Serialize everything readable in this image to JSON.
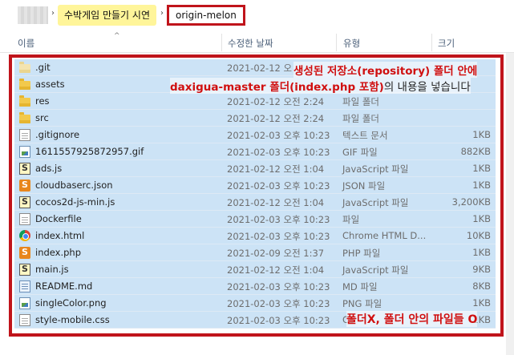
{
  "breadcrumb": {
    "parent": "수박게임 만들기 시연",
    "current": "origin-melon"
  },
  "columns": {
    "name": "이름",
    "date": "수정한 날짜",
    "type": "유형",
    "size": "크기"
  },
  "files": [
    {
      "name": ".git",
      "date": "2021-02-12 오",
      "type": "",
      "size": "",
      "icon": "folder-pale-icon"
    },
    {
      "name": "assets",
      "date": "",
      "type": "",
      "size": "",
      "icon": "folder-icon"
    },
    {
      "name": "res",
      "date": "2021-02-12 오전 2:24",
      "type": "파일 폴더",
      "size": "",
      "icon": "folder-icon"
    },
    {
      "name": "src",
      "date": "2021-02-12 오전 2:24",
      "type": "파일 폴더",
      "size": "",
      "icon": "folder-icon"
    },
    {
      "name": ".gitignore",
      "date": "2021-02-03 오후 10:23",
      "type": "텍스트 문서",
      "size": "1KB",
      "icon": "text-file-icon"
    },
    {
      "name": "1611557925872957.gif",
      "date": "2021-02-03 오후 10:23",
      "type": "GIF 파일",
      "size": "882KB",
      "icon": "image-file-icon"
    },
    {
      "name": "ads.js",
      "date": "2021-02-12 오전 1:04",
      "type": "JavaScript 파일",
      "size": "1KB",
      "icon": "js-file-icon"
    },
    {
      "name": "cloudbaserc.json",
      "date": "2021-02-03 오후 10:23",
      "type": "JSON 파일",
      "size": "1KB",
      "icon": "json-file-icon"
    },
    {
      "name": "cocos2d-js-min.js",
      "date": "2021-02-12 오전 1:04",
      "type": "JavaScript 파일",
      "size": "3,200KB",
      "icon": "js-file-icon"
    },
    {
      "name": "Dockerfile",
      "date": "2021-02-03 오후 10:23",
      "type": "파일",
      "size": "1KB",
      "icon": "text-file-icon"
    },
    {
      "name": "index.html",
      "date": "2021-02-03 오후 10:23",
      "type": "Chrome HTML D...",
      "size": "10KB",
      "icon": "chrome-icon"
    },
    {
      "name": "index.php",
      "date": "2021-02-09 오전 1:37",
      "type": "PHP 파일",
      "size": "1KB",
      "icon": "json-file-icon"
    },
    {
      "name": "main.js",
      "date": "2021-02-12 오전 1:04",
      "type": "JavaScript 파일",
      "size": "9KB",
      "icon": "js-file-icon"
    },
    {
      "name": "README.md",
      "date": "2021-02-03 오후 10:23",
      "type": "MD 파일",
      "size": "8KB",
      "icon": "md-file-icon"
    },
    {
      "name": "singleColor.png",
      "date": "2021-02-03 오후 10:23",
      "type": "PNG 파일",
      "size": "1KB",
      "icon": "image-file-icon"
    },
    {
      "name": "style-mobile.css",
      "date": "2021-02-03 오후 10:23",
      "type": "CS",
      "size": "1KB",
      "icon": "text-file-icon"
    }
  ],
  "annotations": {
    "line1": "생성된 저장소(repository) 폴더 안에",
    "line2_red": "daxigua-master 폴더(index.php 포함)",
    "line2_rest": "의 내용을 넣습니다",
    "bottom": "폴더X, 폴더 안의 파일들 O"
  },
  "colors": {
    "highlight": "#fff59a",
    "annotation_red": "#c0141b",
    "selection": "#cce3f6"
  }
}
